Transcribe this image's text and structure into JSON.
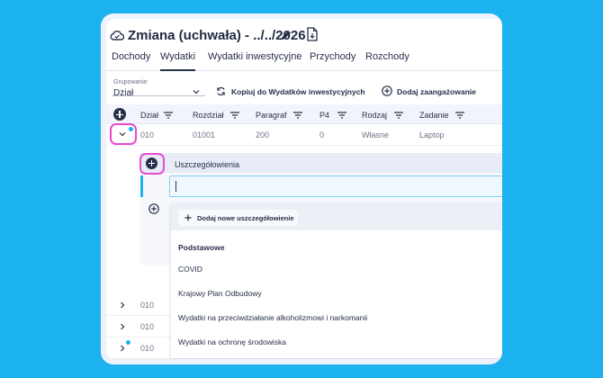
{
  "header": {
    "title": "Zmiana (uchwała) - ../../2026"
  },
  "tabs": [
    {
      "label": "Dochody",
      "active": false
    },
    {
      "label": "Wydatki",
      "active": true
    },
    {
      "label": "Wydatki inwestycyjne",
      "active": false
    },
    {
      "label": "Przychody",
      "active": false
    },
    {
      "label": "Rozchody",
      "active": false
    }
  ],
  "toolbar": {
    "grouping_label": "Grupowanie",
    "grouping_value": "Dział",
    "copy_button": "Kopiuj do Wydatków inwestycyjnych",
    "add_button": "Dodaj zaangażowanie"
  },
  "table": {
    "columns": [
      "Dział",
      "Rozdział",
      "Paragraf",
      "P4",
      "Rodzaj",
      "Zadanie"
    ],
    "expanded_row": [
      "010",
      "01001",
      "200",
      "0",
      "Własne",
      "Laptop"
    ],
    "collapsed_rows": [
      "010",
      "010",
      "010"
    ]
  },
  "details": {
    "title": "Uszczegółowienia",
    "search_value": "",
    "add_new_label": "Dodaj nowe uszczegółowienie",
    "section_label": "Podstawowe",
    "items": [
      "COVID",
      "Krajowy Plan Odbudowy",
      "Wydatki na przeciwdziałanie alkoholizmowi i narkomanii",
      "Wydatki na ochronę środowiska"
    ]
  },
  "colors": {
    "background": "#1cb2f0",
    "highlight": "#e64bd0",
    "primary": "#27304a",
    "accent": "#1cb2f0"
  }
}
